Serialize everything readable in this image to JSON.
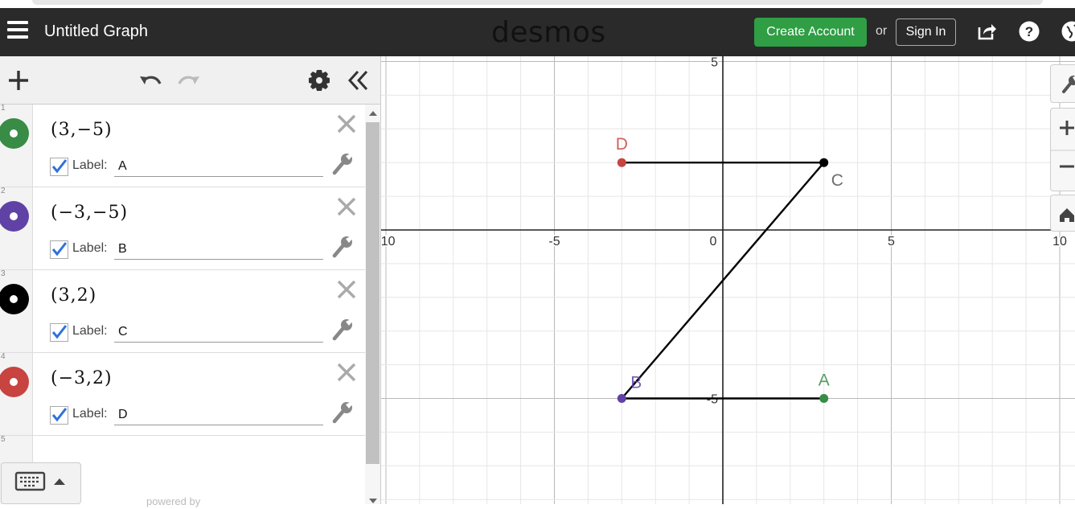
{
  "header": {
    "title": "Untitled Graph",
    "logo": "desmos",
    "create_account": "Create Account",
    "or": "or",
    "sign_in": "Sign In"
  },
  "colors": {
    "green": "#388c46",
    "purple": "#6042a6",
    "black": "#000000",
    "red": "#c74440",
    "header_bg": "#2a2a2a",
    "create_btn": "#2f9e44",
    "check": "#2f72dc"
  },
  "expressions": [
    {
      "num": "1",
      "latex": "(3,−5)",
      "label_text": "Label:",
      "label_value": "A",
      "color_name": "green"
    },
    {
      "num": "2",
      "latex": "(−3,−5)",
      "label_text": "Label:",
      "label_value": "B",
      "color_name": "purple"
    },
    {
      "num": "3",
      "latex": "(3,2)",
      "label_text": "Label:",
      "label_value": "C",
      "color_name": "black"
    },
    {
      "num": "4",
      "latex": "(−3,2)",
      "label_text": "Label:",
      "label_value": "D",
      "color_name": "red"
    },
    {
      "num": "5"
    }
  ],
  "footer": {
    "powered_by": "powered by"
  },
  "chart_data": {
    "type": "scatter",
    "xlim": [
      -10,
      10
    ],
    "ylim": [
      -8.1,
      5.2
    ],
    "x_ticks": [
      -10,
      -5,
      0,
      5,
      10
    ],
    "y_ticks": [
      5,
      -5
    ],
    "x_tick_labels": [
      "-10",
      "-5",
      "0",
      "5",
      "10"
    ],
    "y_tick_labels": [
      "5",
      "-5"
    ],
    "grid": true,
    "points": [
      {
        "label": "A",
        "x": 3,
        "y": -5,
        "color": "#388c46"
      },
      {
        "label": "B",
        "x": -3,
        "y": -5,
        "color": "#6042a6"
      },
      {
        "label": "C",
        "x": 3,
        "y": 2,
        "color": "#000000"
      },
      {
        "label": "D",
        "x": -3,
        "y": 2,
        "color": "#c74440"
      }
    ],
    "segments": [
      {
        "from": [
          -3,
          -5
        ],
        "to": [
          3,
          -5
        ]
      },
      {
        "from": [
          -3,
          -5
        ],
        "to": [
          3,
          2
        ]
      },
      {
        "from": [
          -3,
          2
        ],
        "to": [
          3,
          2
        ]
      }
    ]
  }
}
